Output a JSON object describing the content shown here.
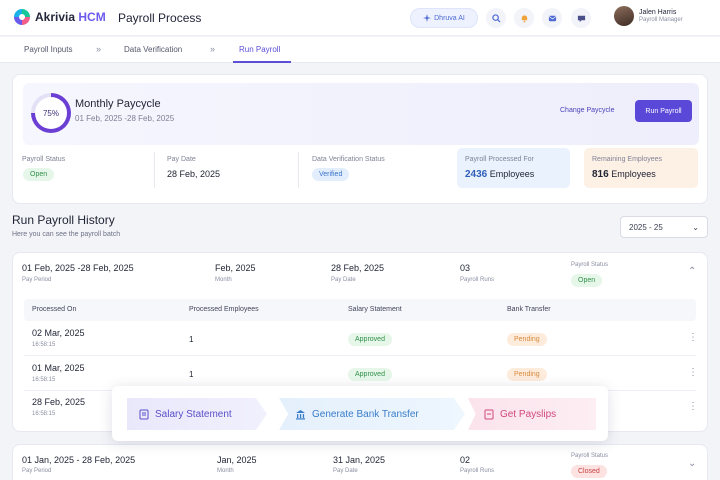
{
  "app": {
    "brand_main": "Akrivia",
    "brand_accent": "HCM",
    "title": "Payroll Process"
  },
  "header": {
    "ai_label": "Dhruva AI",
    "user_name": "Jalen Harris",
    "user_role": "Payroll Manager"
  },
  "breadcrumb": [
    "Payroll Inputs",
    "Data Verification",
    "Run Payroll"
  ],
  "paycycle": {
    "progress_label": "75%",
    "progress": 0.75,
    "title": "Monthly Paycycle",
    "range": "01 Feb, 2025 -28 Feb, 2025",
    "change_label": "Change Paycycle",
    "run_label": "Run Payroll",
    "stats": {
      "status_label": "Payroll Status",
      "status_value": "Open",
      "paydate_label": "Pay Date",
      "paydate_value": "28 Feb, 2025",
      "verification_label": "Data Verification Status",
      "verification_value": "Verified",
      "processed_label": "Payroll Processed For",
      "processed_num": "2436",
      "processed_unit": "Employees",
      "remaining_label": "Remaining Employees",
      "remaining_num": "816",
      "remaining_unit": "Employees"
    }
  },
  "history": {
    "title": "Run Payroll History",
    "subtitle": "Here you can see the payroll batch",
    "year": "2025 - 25",
    "batch1": {
      "period": "01 Feb, 2025 -28 Feb, 2025",
      "period_label": "Pay Period",
      "month": "Feb, 2025",
      "month_label": "Month",
      "paydate": "28 Feb, 2025",
      "paydate_label": "Pay Date",
      "runs": "03",
      "runs_label": "Payroll Runs",
      "status_label": "Payroll Status",
      "status": "Open"
    },
    "columns": [
      "Processed On",
      "Processed Employees",
      "Salary Statement",
      "Bank Transfer"
    ],
    "rows": [
      {
        "date": "02 Mar, 2025",
        "time": "16:58:15",
        "employees": "1",
        "salary": "Approved",
        "bank": "Pending"
      },
      {
        "date": "01 Mar, 2025",
        "time": "16:58:15",
        "employees": "1",
        "salary": "Approved",
        "bank": "Pending"
      },
      {
        "date": "28 Feb, 2025",
        "time": "16:58:15"
      }
    ],
    "batch2": {
      "period": "01 Jan, 2025 - 28 Feb, 2025",
      "period_label": "Pay Period",
      "month": "Jan, 2025",
      "month_label": "Month",
      "paydate": "31 Jan, 2025",
      "paydate_label": "Pay Date",
      "runs": "02",
      "runs_label": "Payroll Runs",
      "status_label": "Payroll Status",
      "status": "Closed"
    }
  },
  "actions": {
    "salary_statement": "Salary Statement",
    "bank_transfer": "Generate Bank Transfer",
    "payslips": "Get Payslips"
  },
  "colors": {
    "accent": "#5a48d8",
    "approved": "#2f8f48",
    "pending": "#d98a3e",
    "closed": "#c94242"
  }
}
